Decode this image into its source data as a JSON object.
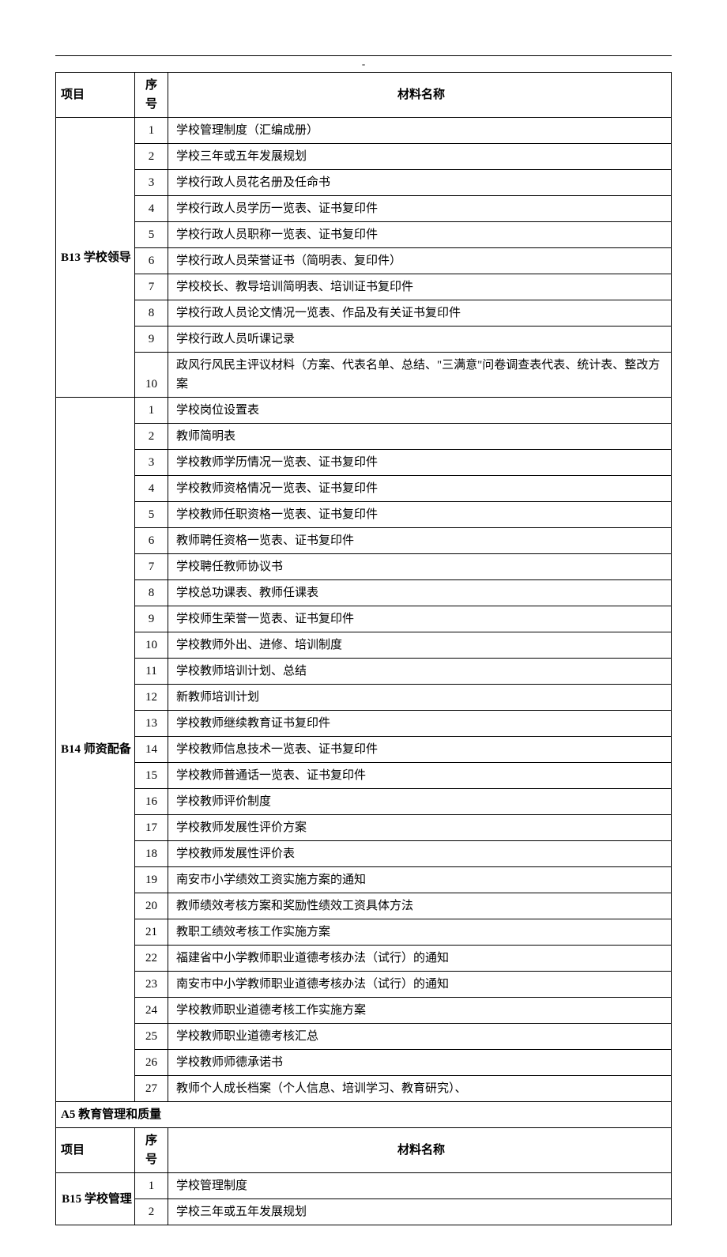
{
  "dash": "-",
  "headers": {
    "project": "项目",
    "seq": "序号",
    "name": "材料名称"
  },
  "sections": {
    "b13": {
      "title": "B13 学校领导",
      "rows": [
        {
          "n": "1",
          "t": "学校管理制度（汇编成册）"
        },
        {
          "n": "2",
          "t": "学校三年或五年发展规划"
        },
        {
          "n": "3",
          "t": "学校行政人员花名册及任命书"
        },
        {
          "n": "4",
          "t": "学校行政人员学历一览表、证书复印件"
        },
        {
          "n": "5",
          "t": "学校行政人员职称一览表、证书复印件"
        },
        {
          "n": "6",
          "t": "学校行政人员荣誉证书（简明表、复印件）"
        },
        {
          "n": "7",
          "t": "学校校长、教导培训简明表、培训证书复印件"
        },
        {
          "n": "8",
          "t": "学校行政人员论文情况一览表、作品及有关证书复印件"
        },
        {
          "n": "9",
          "t": "学校行政人员听课记录"
        },
        {
          "n": "10",
          "t": "政风行风民主评议材料（方案、代表名单、总结、\"三满意\"问卷调查表代表、统计表、整改方案"
        }
      ]
    },
    "b14": {
      "title": "B14 师资配备",
      "rows": [
        {
          "n": "1",
          "t": "学校岗位设置表"
        },
        {
          "n": "2",
          "t": "教师简明表"
        },
        {
          "n": "3",
          "t": "学校教师学历情况一览表、证书复印件"
        },
        {
          "n": "4",
          "t": "学校教师资格情况一览表、证书复印件"
        },
        {
          "n": "5",
          "t": "学校教师任职资格一览表、证书复印件"
        },
        {
          "n": "6",
          "t": "教师聘任资格一览表、证书复印件"
        },
        {
          "n": "7",
          "t": "学校聘任教师协议书"
        },
        {
          "n": "8",
          "t": "学校总功课表、教师任课表"
        },
        {
          "n": "9",
          "t": "学校师生荣誉一览表、证书复印件"
        },
        {
          "n": "10",
          "t": "学校教师外出、进修、培训制度"
        },
        {
          "n": "11",
          "t": "学校教师培训计划、总结"
        },
        {
          "n": "12",
          "t": "新教师培训计划"
        },
        {
          "n": "13",
          "t": "学校教师继续教育证书复印件"
        },
        {
          "n": "14",
          "t": "学校教师信息技术一览表、证书复印件"
        },
        {
          "n": "15",
          "t": "学校教师普通话一览表、证书复印件"
        },
        {
          "n": "16",
          "t": "学校教师评价制度"
        },
        {
          "n": "17",
          "t": "学校教师发展性评价方案"
        },
        {
          "n": "18",
          "t": "学校教师发展性评价表"
        },
        {
          "n": "19",
          "t": "南安市小学绩效工资实施方案的通知"
        },
        {
          "n": "20",
          "t": "教师绩效考核方案和奖励性绩效工资具体方法"
        },
        {
          "n": "21",
          "t": "教职工绩效考核工作实施方案"
        },
        {
          "n": "22",
          "t": "福建省中小学教师职业道德考核办法（试行）的通知"
        },
        {
          "n": "23",
          "t": "南安市中小学教师职业道德考核办法（试行）的通知"
        },
        {
          "n": "24",
          "t": "学校教师职业道德考核工作实施方案"
        },
        {
          "n": "25",
          "t": "学校教师职业道德考核汇总"
        },
        {
          "n": "26",
          "t": "学校教师师德承诺书"
        },
        {
          "n": "27",
          "t": "教师个人成长档案（个人信息、培训学习、教育研究）、"
        }
      ]
    },
    "a5": {
      "heading": "A5 教育管理和质量"
    },
    "b15": {
      "title": "B15 学校管理",
      "rows": [
        {
          "n": "1",
          "t": "学校管理制度"
        },
        {
          "n": "2",
          "t": "学校三年或五年发展规划"
        }
      ]
    }
  }
}
